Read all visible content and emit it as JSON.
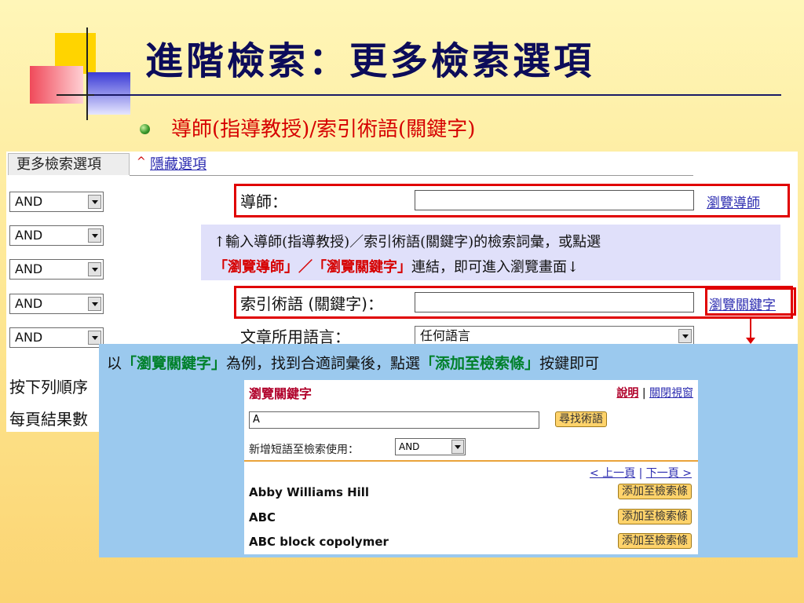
{
  "title": "進階檢索：更多檢索選項",
  "subtitle": "導師(指導教授)/索引術語(關鍵字)",
  "panel": {
    "tab_label": "更多檢索選項",
    "hide_link": "隱藏選項",
    "hide_caret": "^",
    "operators": [
      "AND",
      "AND",
      "AND",
      "AND",
      "AND"
    ],
    "fields": {
      "advisor_label": "導師：",
      "index_label": "索引術語 (關鍵字)：",
      "language_label": "文章所用語言：",
      "language_value": "任何語言"
    },
    "links": {
      "browse_advisor": "瀏覽導師",
      "browse_keyword": "瀏覽關鍵字"
    },
    "left_rows": [
      "按下列順序",
      "每頁結果數"
    ]
  },
  "callout1": {
    "line1": "↑輸入導師(指導教授)／索引術語(關鍵字)的檢索詞彙，或點選",
    "line2_red1": "「瀏覽導師」／「瀏覽關鍵字」",
    "line2_rest": "連結，即可進入瀏覽畫面↓"
  },
  "callout2": {
    "pre": "以",
    "green1": "「瀏覽關鍵字」",
    "mid": "為例，找到合適詞彙後，點選",
    "green2": "「添加至檢索條」",
    "post": "按鍵即可"
  },
  "browse_window": {
    "title": "瀏覽關鍵字",
    "help": "說明",
    "sep": "|",
    "close": "關閉視窗",
    "search_value": "A",
    "find_button": "尋找術語",
    "add_label": "新增短語至檢索使用：",
    "add_operator": "AND",
    "prev": "< 上一頁",
    "next": "下一頁 >",
    "terms": [
      {
        "name": "Abby Williams Hill",
        "button": "添加至檢索條"
      },
      {
        "name": "ABC",
        "button": "添加至檢索條"
      },
      {
        "name": "ABC block copolymer",
        "button": "添加至檢索條"
      }
    ]
  },
  "colors": {
    "title": "#0c0c5a",
    "subtitle": "#d60000",
    "highlight_red": "#e00000",
    "callout_green": "#00802a",
    "callout2_bg": "#9bc9ee",
    "callout1_bg": "#e0e0fa"
  }
}
